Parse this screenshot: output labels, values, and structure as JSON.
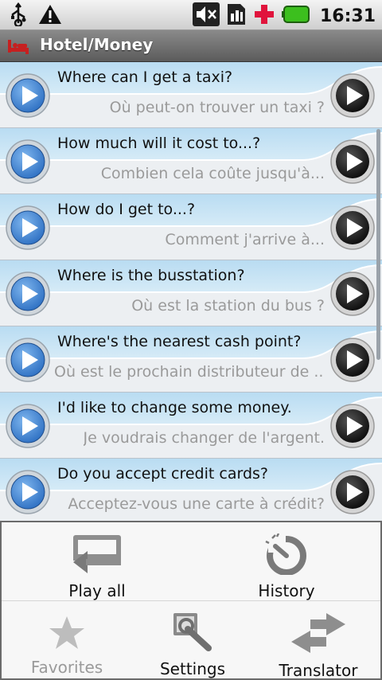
{
  "status": {
    "time": "16:31",
    "icons": [
      "usb-icon",
      "warning-icon",
      "mute-icon",
      "sim-icon",
      "medical-cross-icon",
      "battery-icon"
    ]
  },
  "title": {
    "text": "Hotel/Money",
    "icon": "hotel-bed-icon"
  },
  "phrases": [
    {
      "en": "Where can I get a taxi?",
      "fr": "Où peut-on trouver un taxi ?"
    },
    {
      "en": "How much will it cost to...?",
      "fr": "Combien cela coûte jusqu'à..."
    },
    {
      "en": "How do I get to...?",
      "fr": "Comment j'arrive à..."
    },
    {
      "en": "Where is the busstation?",
      "fr": "Où est la station du bus ?"
    },
    {
      "en": "Where's the nearest cash point?",
      "fr": "Où est le prochain distributeur de ..."
    },
    {
      "en": "I'd like to change some money.",
      "fr": "Je voudrais changer de l'argent."
    },
    {
      "en": "Do you accept credit cards?",
      "fr": "Acceptez-vous une carte à crédit?"
    }
  ],
  "menu": {
    "play_all": "Play all",
    "history": "History",
    "favorites": "Favorites",
    "settings": "Settings",
    "translator": "Translator"
  },
  "colors": {
    "accent_blue": "#3a7fd0",
    "title_bar": "#6e6e6e",
    "disabled_text": "#9a9a9a"
  }
}
